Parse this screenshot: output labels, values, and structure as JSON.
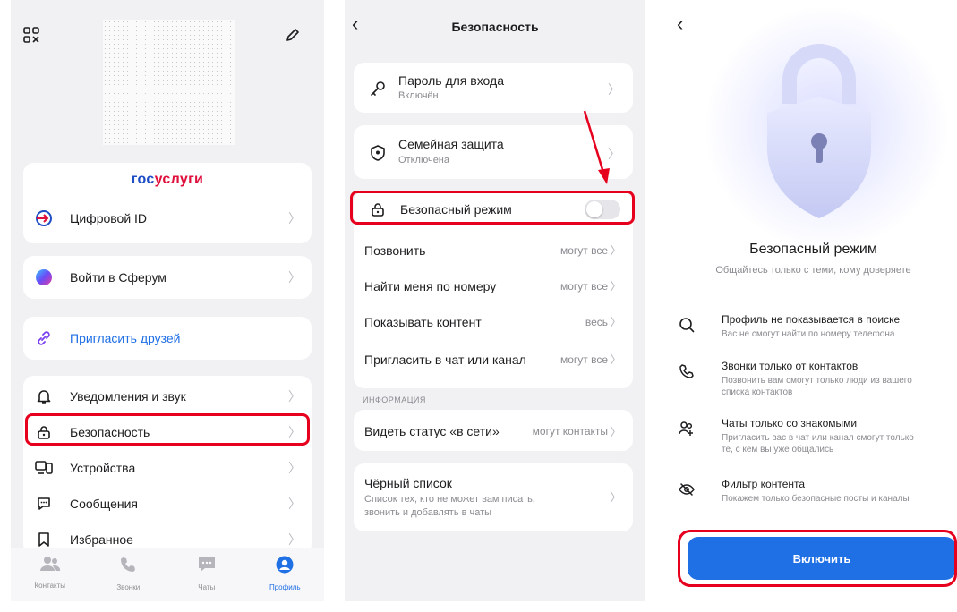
{
  "screen1": {
    "brand": {
      "part1": "гос",
      "part2": "услуги"
    },
    "items_top": [
      {
        "label": "Цифровой ID"
      },
      {
        "label": "Войти в Сферум"
      },
      {
        "label": "Пригласить друзей"
      }
    ],
    "menu": [
      {
        "label": "Уведомления и звук"
      },
      {
        "label": "Безопасность"
      },
      {
        "label": "Устройства"
      },
      {
        "label": "Сообщения"
      },
      {
        "label": "Избранное"
      }
    ],
    "tabs": [
      {
        "label": "Контакты"
      },
      {
        "label": "Звонки"
      },
      {
        "label": "Чаты"
      },
      {
        "label": "Профиль"
      }
    ]
  },
  "screen2": {
    "title": "Безопасность",
    "password": {
      "label": "Пароль для входа",
      "sub": "Включён"
    },
    "family": {
      "label": "Семейная защита",
      "sub": "Отключена"
    },
    "safe_mode": {
      "label": "Безопасный режим",
      "enabled": false
    },
    "settings": [
      {
        "label": "Позвонить",
        "value": "могут все"
      },
      {
        "label": "Найти меня по номеру",
        "value": "могут все"
      },
      {
        "label": "Показывать контент",
        "value": "весь"
      },
      {
        "label": "Пригласить в чат или канал",
        "value": "могут все"
      }
    ],
    "section": "ИНФОРМАЦИЯ",
    "online": {
      "label": "Видеть статус «в сети»",
      "value": "могут контакты"
    },
    "blacklist": {
      "label": "Чёрный список",
      "sub1": "Список тех, кто не может вам писать,",
      "sub2": "звонить и добавлять в чаты"
    }
  },
  "screen3": {
    "title": "Безопасный режим",
    "subtitle": "Общайтесь только с теми, кому доверяете",
    "features": [
      {
        "title": "Профиль не показывается в поиске",
        "desc1": "Вас не смогут найти по номеру телефона",
        "desc2": ""
      },
      {
        "title": "Звонки только от контактов",
        "desc1": "Позвонить вам смогут только люди из вашего",
        "desc2": "списка контактов"
      },
      {
        "title": "Чаты только со знакомыми",
        "desc1": "Пригласить вас в чат или канал смогут только",
        "desc2": "те, с кем вы уже общались"
      },
      {
        "title": "Фильтр контента",
        "desc1": "Покажем только безопасные посты и каналы",
        "desc2": ""
      }
    ],
    "button": "Включить"
  },
  "colors": {
    "accent": "#1f6fe5",
    "highlight": "#e6001e",
    "background": "#f1f1f4"
  }
}
